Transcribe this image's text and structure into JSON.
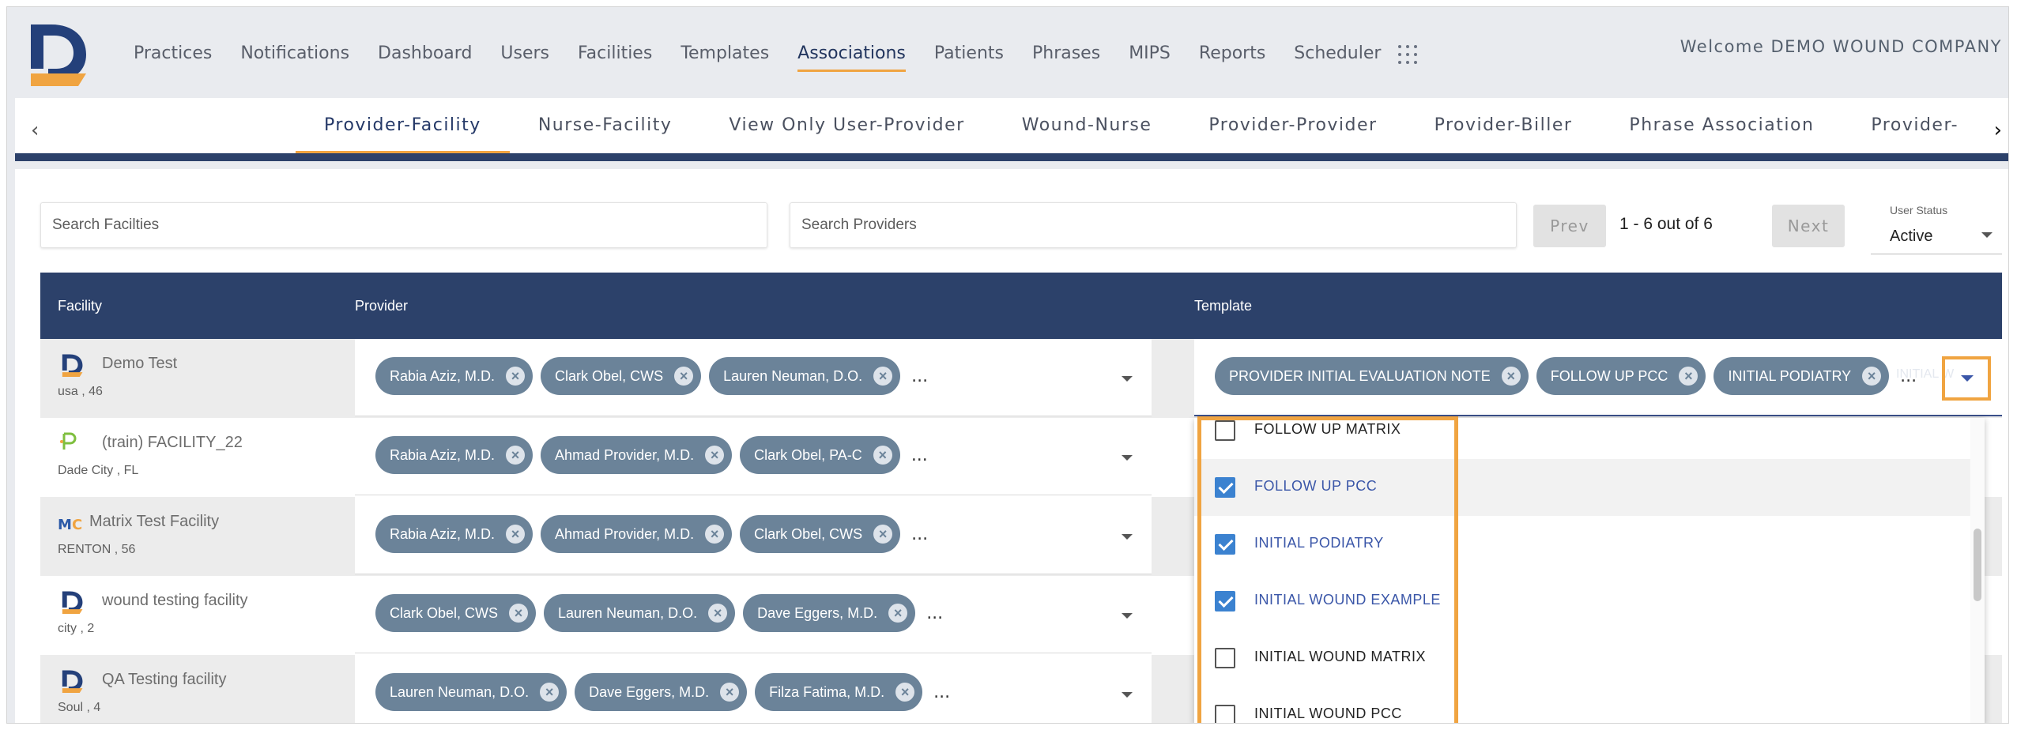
{
  "nav": {
    "items": [
      "Practices",
      "Notifications",
      "Dashboard",
      "Users",
      "Facilities",
      "Templates",
      "Associations",
      "Patients",
      "Phrases",
      "MIPS",
      "Reports",
      "Scheduler"
    ],
    "active": "Associations",
    "welcome": "Welcome DEMO WOUND COMPANY"
  },
  "icons": {
    "back": "chevron-left-icon",
    "forward": "chevron-right-icon",
    "apps": "grid-apps-icon",
    "remove": "close-circle-icon"
  },
  "colors": {
    "accent": "#f0a441",
    "header": "#2c416a",
    "chip": "#6b8399",
    "checkbox": "#3b82d0"
  },
  "subtabs": {
    "items": [
      "Provider-Facility",
      "Nurse-Facility",
      "View Only User-Provider",
      "Wound-Nurse",
      "Provider-Provider",
      "Provider-Biller",
      "Phrase Association",
      "Provider-"
    ],
    "active": "Provider-Facility"
  },
  "search": {
    "facilities_placeholder": "Search Facilties",
    "providers_placeholder": "Search Providers"
  },
  "pagination": {
    "prev": "Prev",
    "next": "Next",
    "info": "1 - 6 out of 6"
  },
  "user_status": {
    "label": "User Status",
    "value": "Active"
  },
  "table": {
    "headers": {
      "facility": "Facility",
      "provider": "Provider",
      "template": "Template"
    },
    "rows": [
      {
        "name": "Demo Test",
        "sub": "usa , 46",
        "providers": [
          "Rabia Aziz, M.D.",
          "Clark Obel, CWS",
          "Lauren Neuman, D.O."
        ]
      },
      {
        "name": "(train) FACILITY_22",
        "sub": "Dade City , FL",
        "providers": [
          "Rabia Aziz, M.D.",
          "Ahmad Provider, M.D.",
          "Clark Obel, PA-C"
        ]
      },
      {
        "name": "Matrix Test Facility",
        "sub": "RENTON , 56",
        "providers": [
          "Rabia Aziz, M.D.",
          "Ahmad Provider, M.D.",
          "Clark Obel, CWS"
        ]
      },
      {
        "name": "wound testing facility",
        "sub": "city , 2",
        "providers": [
          "Clark Obel, CWS",
          "Lauren Neuman, D.O.",
          "Dave Eggers, M.D."
        ]
      },
      {
        "name": "QA Testing facility",
        "sub": "Soul , 4",
        "providers": [
          "Lauren Neuman, D.O.",
          "Dave Eggers, M.D.",
          "Filza Fatima, M.D."
        ]
      }
    ],
    "more": "...",
    "row1_templates": [
      "PROVIDER INITIAL EVALUATION NOTE",
      "FOLLOW UP PCC",
      "INITIAL PODIATRY"
    ],
    "row1_overflow": "INITIAL W"
  },
  "dropdown": {
    "options": [
      {
        "label": "FOLLOW UP MATRIX",
        "checked": false
      },
      {
        "label": "FOLLOW UP PCC",
        "checked": true
      },
      {
        "label": "INITIAL PODIATRY",
        "checked": true
      },
      {
        "label": "INITIAL WOUND EXAMPLE",
        "checked": true
      },
      {
        "label": "INITIAL WOUND MATRIX",
        "checked": false
      },
      {
        "label": "INITIAL WOUND PCC",
        "checked": false
      }
    ]
  }
}
